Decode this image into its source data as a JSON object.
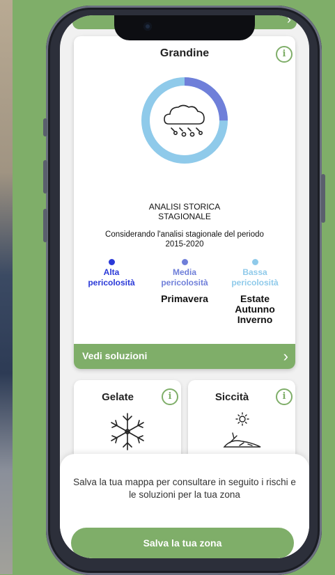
{
  "hazard_card": {
    "title": "Grandine",
    "analysis_label": [
      "ANALISI STORICA",
      "STAGIONALE"
    ],
    "period_label": [
      "Considerando l'analisi stagionale del periodo",
      "2015-2020"
    ],
    "legend": [
      {
        "label": [
          "Alta",
          "pericolosità"
        ],
        "color": "#2a39d8",
        "seasons": []
      },
      {
        "label": [
          "Media",
          "pericolosità"
        ],
        "color": "#6f7fd9",
        "seasons": [
          "Primavera"
        ]
      },
      {
        "label": [
          "Bassa",
          "pericolosità"
        ],
        "color": "#8fcaea",
        "seasons": [
          "Estate",
          "Autunno",
          "Inverno"
        ]
      }
    ],
    "cta_label": "Vedi soluzioni"
  },
  "donut": {
    "medium_fraction": 0.25,
    "low_fraction": 0.75,
    "medium_color": "#6f7fd9",
    "low_color": "#8fcaea"
  },
  "other_hazards": [
    {
      "title": "Gelate",
      "icon": "snowflake-icon"
    },
    {
      "title": "Siccità",
      "icon": "drought-icon"
    }
  ],
  "bottom_sheet": {
    "text": "Salva la tua mappa per consultare in seguito i rischi e le soluzioni per la tua zona",
    "button_label": "Salva la tua zona"
  },
  "colors": {
    "accent": "#7fae69"
  }
}
